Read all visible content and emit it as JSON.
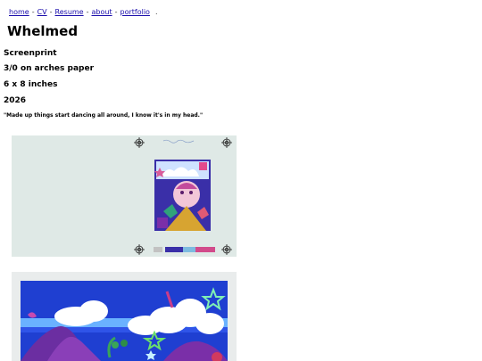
{
  "nav": {
    "links": [
      "home",
      "CV",
      "Resume",
      "about",
      "portfolio"
    ],
    "separator": "-",
    "trailing": "."
  },
  "work": {
    "title": "Whelmed",
    "medium": "Screenprint",
    "edition": "3/0 on arches paper",
    "size": "6 x 8 inches",
    "year": "2026",
    "quote": "\"Made up things start dancing all around, I know it's in my head.\""
  },
  "images": [
    {
      "name": "print-full-sheet-image"
    },
    {
      "name": "print-detail-image"
    }
  ]
}
